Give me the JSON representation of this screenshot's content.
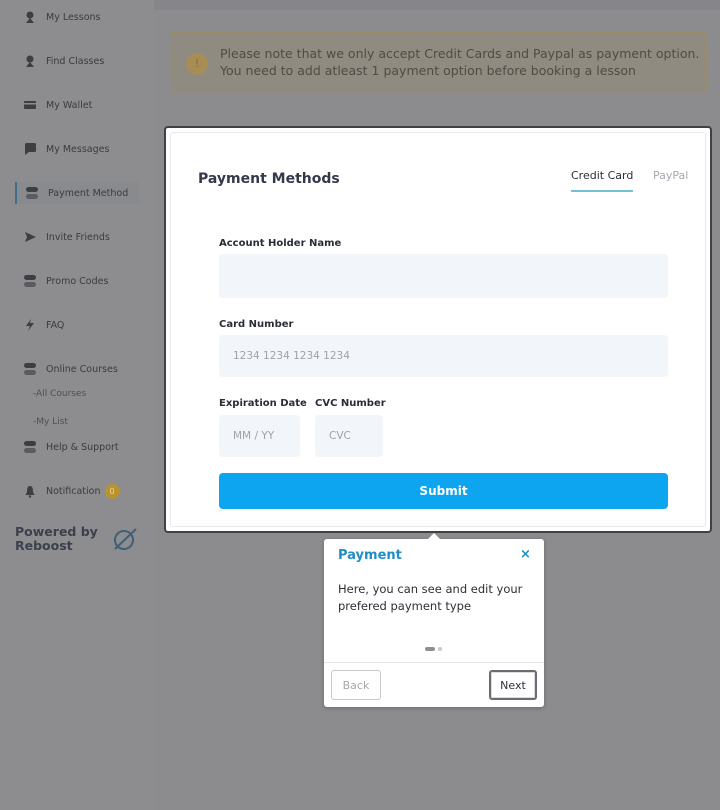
{
  "sidebar": {
    "items": [
      {
        "label": "My Lessons",
        "icon": "user-icon"
      },
      {
        "label": "Find Classes",
        "icon": "user-search-icon"
      },
      {
        "label": "My Wallet",
        "icon": "wallet-icon"
      },
      {
        "label": "My Messages",
        "icon": "chat-icon"
      },
      {
        "label": "Payment Method",
        "icon": "toggle-icon",
        "active": true
      },
      {
        "label": "Invite Friends",
        "icon": "send-icon"
      },
      {
        "label": "Promo Codes",
        "icon": "toggle-icon"
      },
      {
        "label": "FAQ",
        "icon": "lightning-icon"
      },
      {
        "label": "Online Courses",
        "icon": "toggle-icon"
      },
      {
        "label": "Help & Support",
        "icon": "toggle-icon"
      },
      {
        "label": "Notification",
        "icon": "bell-icon",
        "badge": "0"
      }
    ],
    "sub_items": [
      "-All Courses",
      "-My List"
    ],
    "powered_by": "Powered by Reboost"
  },
  "notice": {
    "text": "Please note that we only accept Credit Cards and Paypal as payment option. You need to add atleast 1 payment option before booking a lesson",
    "icon": "!"
  },
  "payment": {
    "title": "Payment Methods",
    "tabs": [
      "Credit Card",
      "PayPal"
    ],
    "active_tab": "Credit Card",
    "account_holder_label": "Account Holder Name",
    "account_holder_value": "",
    "card_number_label": "Card Number",
    "card_number_placeholder": "1234 1234 1234 1234",
    "expiration_label": "Expiration Date",
    "expiration_placeholder": "MM / YY",
    "cvc_label": "CVC Number",
    "cvc_placeholder": "CVC",
    "submit_label": "Submit"
  },
  "tooltip": {
    "title": "Payment",
    "close": "×",
    "body": "Here, you can see and edit your prefered payment type",
    "back_label": "Back",
    "next_label": "Next",
    "step": 1,
    "total_steps": 2
  },
  "colors": {
    "accent": "#0ea5f0",
    "tooltip_title": "#1e8ec7",
    "active_tab_underline": "#73c0d8",
    "overlay": "#8c8c8e"
  }
}
